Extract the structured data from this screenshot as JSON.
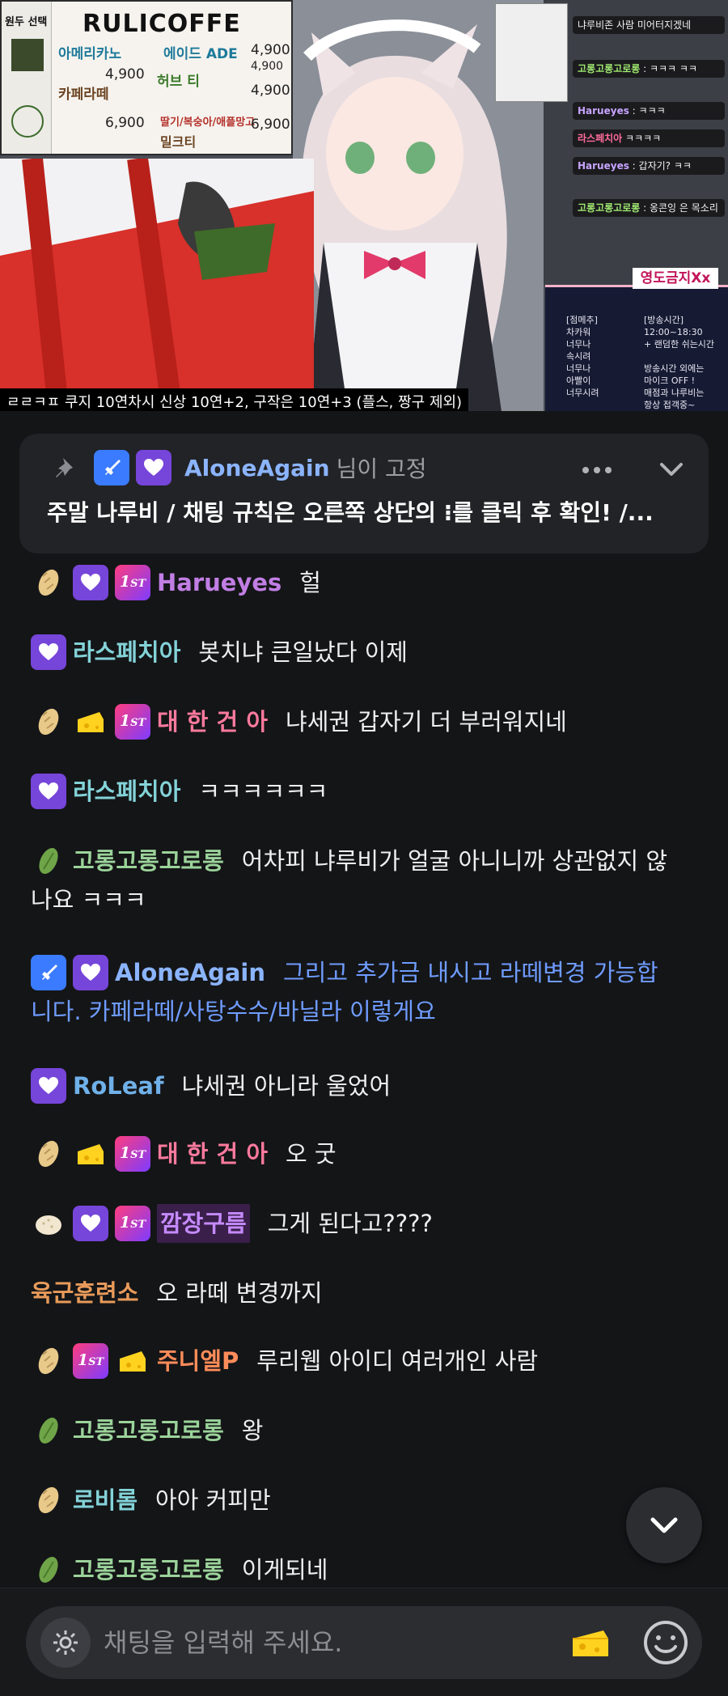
{
  "stream": {
    "side_title": "원두 선택",
    "menu_brand": "RULICOFFE",
    "menu_items": [
      {
        "name": "아메리카노",
        "price": "4,900",
        "color": "#1e7a9a"
      },
      {
        "name": "에이드 ADE",
        "price": "4,900",
        "color": "#1e7a9a"
      },
      {
        "name": "카페라떼",
        "price": "",
        "color": "#6b4423"
      },
      {
        "name": "허브 티",
        "price": "4,900",
        "color": "#3b7a2a"
      },
      {
        "name": "밀크티",
        "price": "6,900",
        "color": "#6b4423"
      },
      {
        "name": "딸기/복숭아/애플망고",
        "price": "6,900",
        "color": "#b5302a"
      }
    ],
    "menu_price_mid": "4,900",
    "menu_price_low": "6,900",
    "mini_chat": [
      {
        "name": "",
        "text": "냐루비존 사람 미어터지겠네",
        "name_color": "#ffffff"
      },
      {
        "name": "고롱고롱고로롱",
        "text": ": ㅋㅋㅋ ㅋㅋ",
        "name_color": "#9fe870"
      },
      {
        "name": "Harueyes",
        "text": ": ㅋㅋㅋ",
        "name_color": "#c7a4ff"
      },
      {
        "name": "라스페치아",
        "text": "ㅋㅋㅋㅋ",
        "name_color": "#ff6b9a"
      },
      {
        "name": "Harueyes",
        "text": ": 갑자기? ㅋㅋ",
        "name_color": "#c7a4ff"
      },
      {
        "name": "고롱고롱고로롱",
        "text": ": 옹콘잉 은 목소리",
        "name_color": "#9fe870"
      }
    ],
    "notice_title": "영도금지Xx",
    "notice_left": "[점메추]\n차카워\n너무나\n속시려\n너무나\n아빨이\n너무시려",
    "notice_right": "[방송시간]\n12:00~18:30\n+ 랜덤한 쉬는시간\n\n방송시간 외에는\n마이크 OFF !\n매점과 냐루비는\n항상 접객중~",
    "caption": "ㄹㄹㅋㅍ 쿠지 10연차시 신상 10연+2, 구작은 10연+3 (플스, 짱구 제외)"
  },
  "pinned": {
    "name": "AloneAgain",
    "suffix": "님이 고정",
    "text": "주말 나루비 / 채팅 규칙은 오른쪽 상단의 ⁝를 클릭 후 확인!  /..."
  },
  "messages": [
    {
      "badges": [
        "egg",
        "heart",
        "first"
      ],
      "name": "Harueyes",
      "name_color": "#c17ee4",
      "text": "헐",
      "cont": "",
      "text_color": "#efeff1"
    },
    {
      "badges": [
        "heart"
      ],
      "name": "라스페치아",
      "name_color": "#83d3d8",
      "text": "봇치냐 큰일났다 이제",
      "cont": "",
      "text_color": "#efeff1"
    },
    {
      "badges": [
        "egg",
        "cheese",
        "first"
      ],
      "name": "대 한 건 아",
      "name_color": "#ff7a9e",
      "text": "냐세권 갑자기 더 부러워지네",
      "cont": "",
      "text_color": "#efeff1"
    },
    {
      "badges": [
        "heart"
      ],
      "name": "라스페치아",
      "name_color": "#83d3d8",
      "text": "ㅋㅋㅋㅋㅋㅋ",
      "cont": "",
      "text_color": "#efeff1"
    },
    {
      "badges": [
        "leaf"
      ],
      "name": "고롱고롱고로롱",
      "name_color": "#9bd39a",
      "text": "어차피 냐루비가 얼굴 아니니까 상관없지 않",
      "cont": "나요 ㅋㅋㅋ",
      "text_color": "#efeff1"
    },
    {
      "badges": [
        "sword",
        "heart"
      ],
      "name": "AloneAgain",
      "name_color": "#8bb4ff",
      "text": "그리고 추가금 내시고 라떼변경 가능합",
      "cont": "니다. 카페라떼/사탕수수/바닐라 이렇게요",
      "text_color": "#6f9cff"
    },
    {
      "badges": [
        "heart"
      ],
      "name": "RoLeaf",
      "name_color": "#6fb0e8",
      "text": "냐세권 아니라 울었어",
      "cont": "",
      "text_color": "#efeff1"
    },
    {
      "badges": [
        "egg",
        "cheese",
        "first"
      ],
      "name": "대 한 건 아",
      "name_color": "#ff7a9e",
      "text": "오 굿",
      "cont": "",
      "text_color": "#efeff1"
    },
    {
      "badges": [
        "bread",
        "heart",
        "first"
      ],
      "name": "깜장구름",
      "name_color": "#c58bff",
      "text": "그게 된다고????",
      "cont": "",
      "text_color": "#efeff1"
    },
    {
      "badges": [],
      "name": "육군훈련소",
      "name_color": "#e89a5a",
      "text": "오 라떼 변경까지",
      "cont": "",
      "text_color": "#efeff1"
    },
    {
      "badges": [
        "egg",
        "first",
        "cheese"
      ],
      "name": "주니엘P",
      "name_color": "#ff8c5a",
      "text": "루리웹 아이디 여러개인 사람",
      "cont": "",
      "text_color": "#efeff1"
    },
    {
      "badges": [
        "leaf"
      ],
      "name": "고롱고롱고로롱",
      "name_color": "#9bd39a",
      "text": "왕",
      "cont": "",
      "text_color": "#efeff1"
    },
    {
      "badges": [
        "egg"
      ],
      "name": "로비롬",
      "name_color": "#83d3d8",
      "text": "아아 커피만",
      "cont": "",
      "text_color": "#efeff1"
    },
    {
      "badges": [
        "leaf"
      ],
      "name": "고롱고롱고로롱",
      "name_color": "#9bd39a",
      "text": "이게되네",
      "cont": "",
      "text_color": "#efeff1"
    }
  ],
  "input": {
    "placeholder": "채팅을 입력해 주세요."
  }
}
